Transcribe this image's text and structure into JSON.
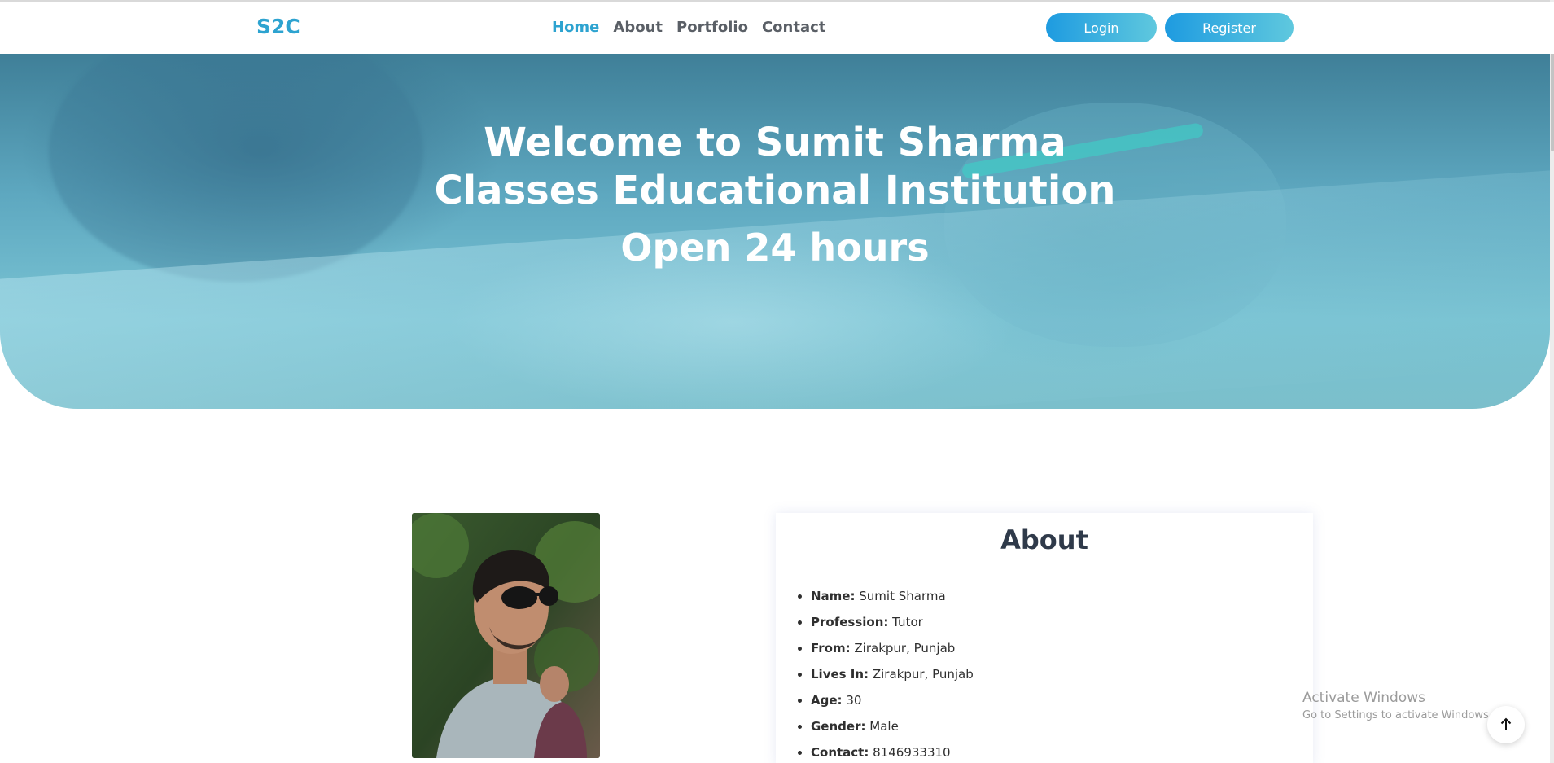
{
  "navbar": {
    "brand": "S2C",
    "links": [
      {
        "label": "Home",
        "active": true
      },
      {
        "label": "About",
        "active": false
      },
      {
        "label": "Portfolio",
        "active": false
      },
      {
        "label": "Contact",
        "active": false
      }
    ],
    "login_label": "Login",
    "register_label": "Register"
  },
  "hero": {
    "title": "Welcome to Sumit Sharma Classes Educational Institution",
    "subtitle": "Open 24 hours"
  },
  "about": {
    "heading": "About",
    "items": [
      {
        "label": "Name:",
        "value": "Sumit Sharma"
      },
      {
        "label": "Profession:",
        "value": "Tutor"
      },
      {
        "label": "From:",
        "value": "Zirakpur, Punjab"
      },
      {
        "label": "Lives In:",
        "value": "Zirakpur, Punjab"
      },
      {
        "label": "Age:",
        "value": "30"
      },
      {
        "label": "Gender:",
        "value": "Male"
      },
      {
        "label": "Contact:",
        "value": "8146933310"
      }
    ]
  },
  "watermark": {
    "title": "Activate Windows",
    "subtitle": "Go to Settings to activate Windows."
  },
  "icons": {
    "back_to_top": "arrow-up-icon"
  },
  "colors": {
    "accent": "#2da3d0",
    "button_gradient_start": "#1e9be0",
    "button_gradient_end": "#5fc8de"
  }
}
